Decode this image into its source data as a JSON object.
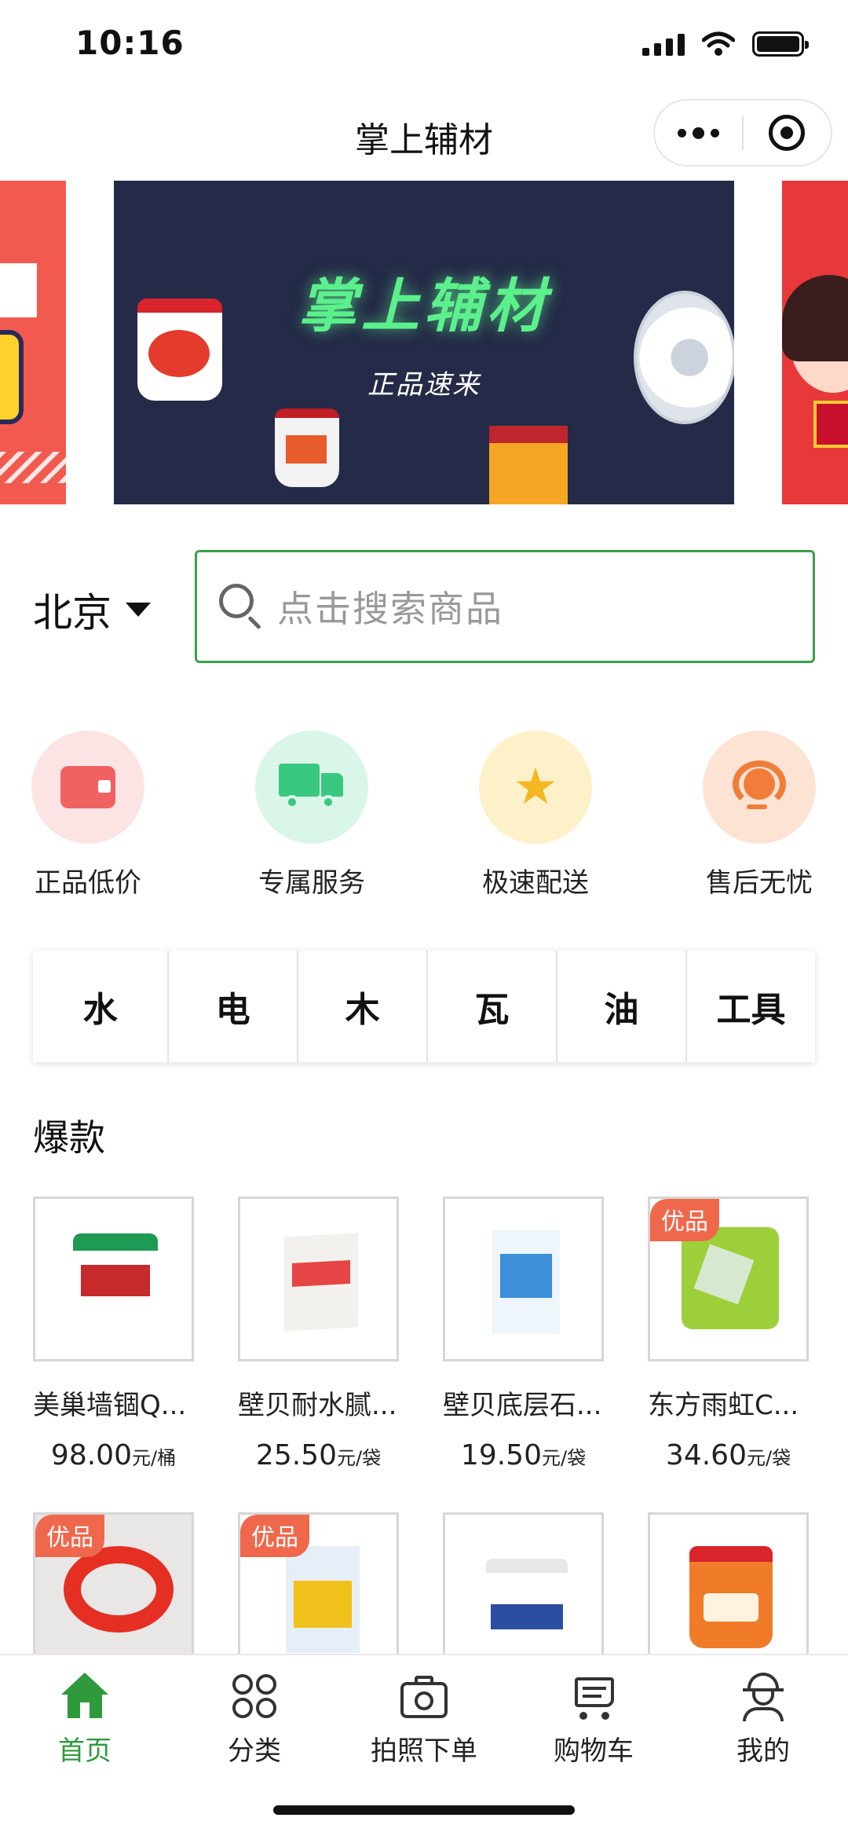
{
  "status_bar": {
    "time": "10:16"
  },
  "header": {
    "title": "掌上辅材"
  },
  "banner": {
    "title": "掌上辅材",
    "subtitle": "正品速来"
  },
  "location": {
    "city": "北京"
  },
  "search": {
    "placeholder": "点击搜索商品"
  },
  "features": [
    {
      "label": "正品低价",
      "icon": "wallet-icon",
      "bg": "#fde4e4"
    },
    {
      "label": "专属服务",
      "icon": "truck-icon",
      "bg": "#d9f6e8"
    },
    {
      "label": "极速配送",
      "icon": "star-icon",
      "bg": "#fdf1c9"
    },
    {
      "label": "售后无忧",
      "icon": "headset-icon",
      "bg": "#fde3d3"
    }
  ],
  "categories": [
    "水",
    "电",
    "木",
    "瓦",
    "油",
    "工具"
  ],
  "hot": {
    "title": "爆款",
    "products": [
      {
        "name": "美巢墙锢Q...",
        "price": "98.00",
        "unit": "元/桶",
        "badge": ""
      },
      {
        "name": "壁贝耐水腻...",
        "price": "25.50",
        "unit": "元/袋",
        "badge": ""
      },
      {
        "name": "壁贝底层石...",
        "price": "19.50",
        "unit": "元/袋",
        "badge": ""
      },
      {
        "name": "东方雨虹C...",
        "price": "34.60",
        "unit": "元/袋",
        "badge": "优品"
      },
      {
        "badge": "优品"
      },
      {
        "badge": "优品"
      },
      {
        "badge": ""
      },
      {
        "badge": ""
      }
    ]
  },
  "tabbar": {
    "items": [
      {
        "label": "首页",
        "icon": "home-icon",
        "active": true
      },
      {
        "label": "分类",
        "icon": "grid-icon",
        "active": false
      },
      {
        "label": "拍照下单",
        "icon": "camera-icon",
        "active": false
      },
      {
        "label": "购物车",
        "icon": "cart-icon",
        "active": false
      },
      {
        "label": "我的",
        "icon": "worker-icon",
        "active": false
      }
    ]
  },
  "colors": {
    "accent_green": "#2e9a3c",
    "badge": "#f0684c",
    "banner_bg": "#242a47"
  }
}
